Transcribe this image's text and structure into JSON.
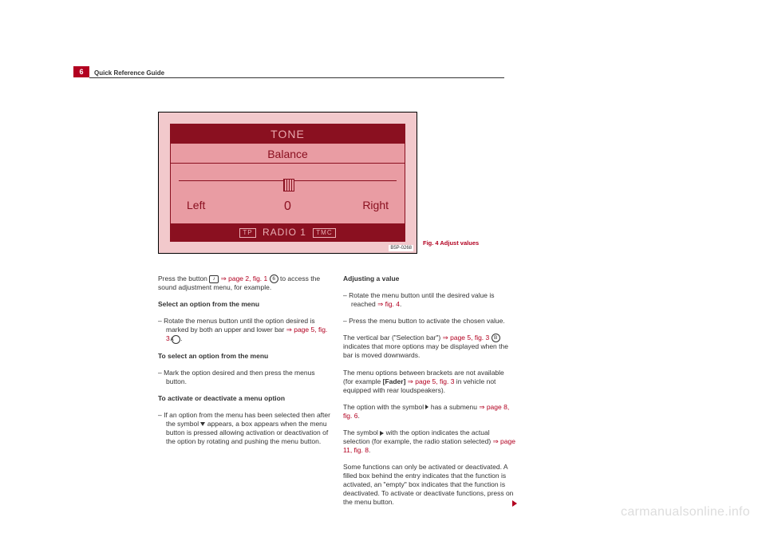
{
  "page_number": "6",
  "header_title": "Quick Reference Guide",
  "radio": {
    "tone": "TONE",
    "balance": "Balance",
    "left": "Left",
    "right": "Right",
    "zero": "0",
    "tp": "TP",
    "source": "RADIO 1",
    "tmc": "TMC",
    "code": "B5P-0268"
  },
  "figure_caption": "Fig. 4  Adjust values",
  "left_col": {
    "p1a": "Press the button ",
    "p1b": " ⇒ page 2, fig. 1 ",
    "p1c": " to access the sound adjust­ment menu, for example.",
    "h1": "Select an option from the menu",
    "li1a": "Rotate the menus button until the option desired is marked by both an upper and lower bar ",
    "li1b": "⇒ page 5, fig. 3 ",
    "li1c": ".",
    "h2": "To select an option from the menu",
    "li2": "Mark the option desired and then press the menus button.",
    "h3": "To activate or deactivate a menu option",
    "li3a": "If an option from the menu has been selected then after the symbol ",
    "li3b": " appears, a box appears when the menu button is pressed allowing activation or deactivation of the option by rotating and pushing the menu button."
  },
  "right_col": {
    "h1": "Adjusting a value",
    "li1a": "Rotate the menu button until the desired value is reached ",
    "li1b": "⇒ fig. 4",
    "li1c": ".",
    "li2": "Press the menu button to activate the chosen value.",
    "p1a": "The vertical bar (\"Selection bar\") ",
    "p1b": "⇒ page 5, fig. 3 ",
    "p1c": " indicates that more options may be displayed when the bar is moved downwards.",
    "p2a": "The menu options between brackets are not available (for example ",
    "p2b": "[Fader]",
    "p2c": " ",
    "p2d": "⇒ page 5, fig. 3",
    "p2e": " in vehicle not equipped with rear loudspeakers).",
    "p3a": "The option with the symbol ",
    "p3b": " has a submenu ",
    "p3c": "⇒ page 8, fig. 6",
    "p3d": ".",
    "p4a": "The symbol ",
    "p4b": " with the option indicates the actual selection (for example, the radio station selected) ",
    "p4c": "⇒ page 11, fig. 8",
    "p4d": ".",
    "p5": "Some functions can only be activated or deactivated. A filled box behind the entry indicates that the function is activated, an \"empty\" box indicates that the function is deactivated. To activate or deactivate functions, press on the menu button."
  },
  "circled": {
    "six": "6",
    "A": "A",
    "B": "B"
  },
  "icons": {
    "music": "♪"
  },
  "watermark": "carmanualsonline.info"
}
